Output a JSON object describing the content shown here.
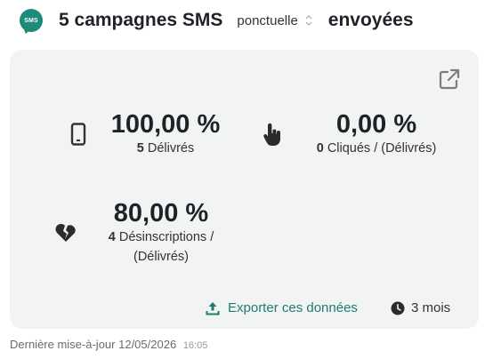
{
  "header": {
    "badge_text": "SMS",
    "title_count": "5 campagnes SMS",
    "type_select": "ponctuelle",
    "status": "envoyées"
  },
  "stats": {
    "delivered": {
      "value": "100,00 %",
      "count": "5",
      "label": "Délivrés"
    },
    "clicked": {
      "value": "0,00 %",
      "count": "0",
      "label": "Cliqués / (Délivrés)"
    },
    "unsubscribed": {
      "value": "80,00 %",
      "count": "4",
      "label_line1": "Désinscriptions /",
      "label_line2": "(Délivrés)"
    }
  },
  "actions": {
    "export_label": "Exporter ces données",
    "period_label": "3 mois"
  },
  "footer": {
    "label": "Dernière mise-à-jour",
    "date": "12/05/2026",
    "time": "16:05"
  },
  "colors": {
    "accent": "#1e7d70",
    "card_bg": "#f2f3f3"
  }
}
